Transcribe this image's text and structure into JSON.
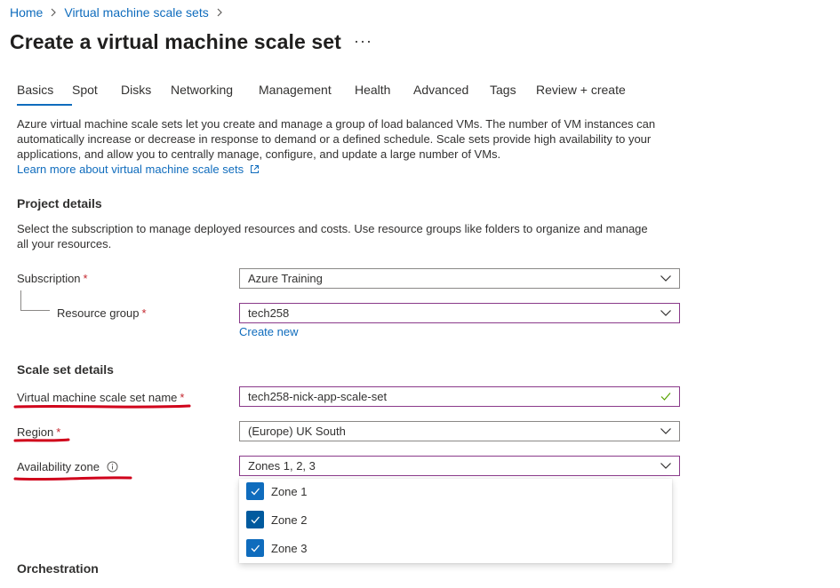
{
  "breadcrumb": {
    "home": "Home",
    "parent": "Virtual machine scale sets",
    "sep": ">"
  },
  "page": {
    "title": "Create a virtual machine scale set",
    "more": "···"
  },
  "tabs": [
    "Basics",
    "Spot",
    "Disks",
    "Networking",
    "Management",
    "Health",
    "Advanced",
    "Tags",
    "Review + create"
  ],
  "intro": {
    "text": "Azure virtual machine scale sets let you create and manage a group of load balanced VMs. The number of VM instances can automatically increase or decrease in response to demand or a defined schedule. Scale sets provide high availability to your applications, and allow you to centrally manage, configure, and update a large number of VMs.",
    "link": "Learn more about virtual machine scale sets"
  },
  "project": {
    "heading": "Project details",
    "text": "Select the subscription to manage deployed resources and costs. Use resource groups like folders to organize and manage all your resources.",
    "subscription_label": "Subscription",
    "subscription_value": "Azure Training",
    "rg_label": "Resource group",
    "rg_value": "tech258",
    "create_new": "Create new"
  },
  "scale": {
    "heading": "Scale set details",
    "name_label": "Virtual machine scale set name",
    "name_value": "tech258-nick-app-scale-set",
    "region_label": "Region",
    "region_value": "(Europe) UK South",
    "zone_label": "Availability zone",
    "zone_value": "Zones 1, 2, 3",
    "zones": [
      "Zone 1",
      "Zone 2",
      "Zone 3"
    ]
  },
  "orchestration": {
    "heading": "Orchestration"
  },
  "required_mark": "*",
  "colors": {
    "accent": "#0f6cbd",
    "required": "#c4262e",
    "annotation": "#d0021b",
    "focus_border": "#8a3a8a"
  }
}
